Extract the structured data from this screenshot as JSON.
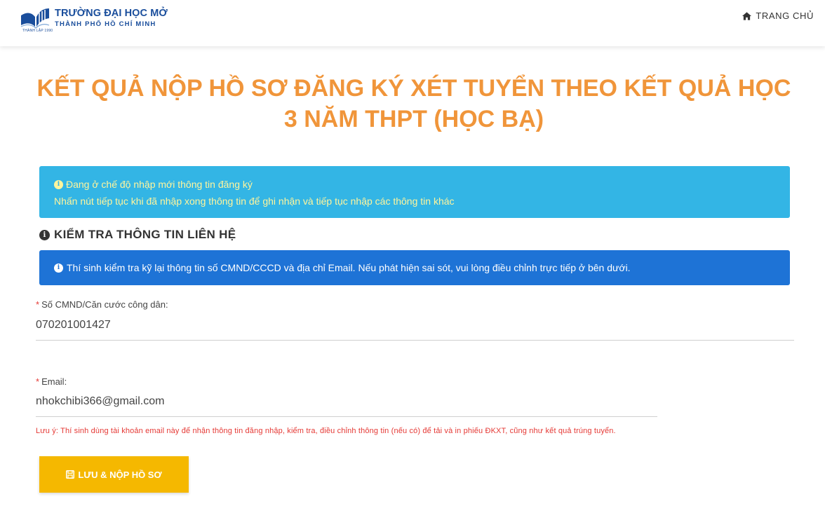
{
  "header": {
    "logo": {
      "name_line1": "TRƯỜNG ĐẠI HỌC MỞ",
      "name_line2": "THÀNH PHỐ HỒ CHÍ MINH",
      "small_text": "THÀNH LẬP 1990"
    },
    "nav": {
      "home_label": "TRANG CHỦ",
      "home_icon": "home-icon"
    }
  },
  "page_title": "KẾT QUẢ NỘP HỒ SƠ ĐĂNG KÝ XÉT TUYỂN THEO KẾT QUẢ HỌC 3 NĂM THPT (HỌC BẠ)",
  "info_alert": {
    "line1": "Đang ở chế độ nhập mới thông tin đăng ký",
    "line2": "Nhấn nút tiếp tục khi đã nhập xong thông tin để ghi nhận và tiếp tục nhập các thông tin khác"
  },
  "section": {
    "title": "KIỂM TRA THÔNG TIN LIÊN HỆ",
    "notice": "Thí sinh kiểm tra kỹ lại thông tin số CMND/CCCD và địa chỉ Email. Nếu phát hiện sai sót, vui lòng điều chỉnh trực tiếp ở bên dưới."
  },
  "form": {
    "id_field": {
      "required_mark": "*",
      "label": "Số CMND/Căn cước công dân:",
      "value": "070201001427"
    },
    "email_field": {
      "required_mark": "*",
      "label": "Email:",
      "value": "nhokchibi366@gmail.com"
    },
    "note": "Lưu ý: Thí sinh dùng tài khoản email này để nhận thông tin đăng nhập, kiểm tra, điều chỉnh thông tin (nếu có) để tải và in phiếu ĐKXT, cũng như kết quả trúng tuyển.",
    "submit_label": "LƯU & NỘP HỒ SƠ"
  },
  "colors": {
    "title": "#f0953a",
    "info_alert_bg": "#33b5e5",
    "info_alert_text": "#fff59d",
    "primary_alert_bg": "#1e73d6",
    "submit_bg": "#f5b800",
    "required": "#e53935",
    "brand": "#1a4e9c"
  }
}
